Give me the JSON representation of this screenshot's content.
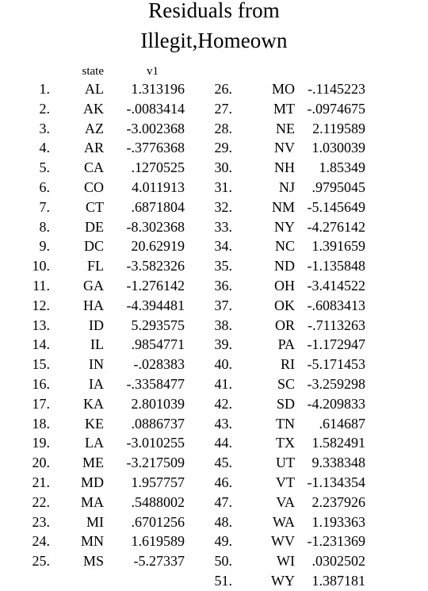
{
  "title": {
    "line1": "Residuals from",
    "line2": "Illegit,Homeown"
  },
  "columns": {
    "index_header": "",
    "state_header": "state",
    "value_header": "v1"
  },
  "chart_data": {
    "type": "table",
    "title": "Residuals from Illegit,Homeown",
    "xlabel": "state",
    "ylabel": "v1",
    "categories": [
      "AL",
      "AK",
      "AZ",
      "AR",
      "CA",
      "CO",
      "CT",
      "DE",
      "DC",
      "FL",
      "GA",
      "HA",
      "ID",
      "IL",
      "IN",
      "IA",
      "KA",
      "KE",
      "LA",
      "ME",
      "MD",
      "MA",
      "MI",
      "MN",
      "MS",
      "MO",
      "MT",
      "NE",
      "NV",
      "NH",
      "NJ",
      "NM",
      "NY",
      "NC",
      "ND",
      "OH",
      "OK",
      "OR",
      "PA",
      "RI",
      "SC",
      "SD",
      "TN",
      "TX",
      "UT",
      "VT",
      "VA",
      "WA",
      "WV",
      "WI",
      "WY"
    ],
    "values": [
      1.313196,
      -0.0083414,
      -3.002368,
      -0.3776368,
      0.1270525,
      4.011913,
      0.6871804,
      -8.302368,
      20.62919,
      -3.582326,
      -1.276142,
      -4.394481,
      5.293575,
      0.9854771,
      -0.028383,
      -0.3358477,
      2.801039,
      0.0886737,
      -3.010255,
      -3.217509,
      1.957757,
      0.5488002,
      0.6701256,
      1.619589,
      -5.27337,
      -0.1145223,
      -0.0974675,
      2.119589,
      1.030039,
      1.85349,
      0.9795045,
      -5.145649,
      -4.276142,
      1.391659,
      -1.135848,
      -3.414522,
      -0.6083413,
      -0.7113263,
      -1.172947,
      -5.171453,
      -3.259298,
      -4.209833,
      0.614687,
      1.582491,
      9.338348,
      -1.134354,
      2.237926,
      1.193363,
      -1.231369,
      0.0302502,
      1.387181
    ]
  },
  "left_rows": [
    {
      "num": "1.",
      "state": "AL",
      "value": "1.313196"
    },
    {
      "num": "2.",
      "state": "AK",
      "value": "-.0083414"
    },
    {
      "num": "3.",
      "state": "AZ",
      "value": "-3.002368"
    },
    {
      "num": "4.",
      "state": "AR",
      "value": "-.3776368"
    },
    {
      "num": "5.",
      "state": "CA",
      "value": ".1270525"
    },
    {
      "num": "6.",
      "state": "CO",
      "value": "4.011913"
    },
    {
      "num": "7.",
      "state": "CT",
      "value": ".6871804"
    },
    {
      "num": "8.",
      "state": "DE",
      "value": "-8.302368"
    },
    {
      "num": "9.",
      "state": "DC",
      "value": "20.62919"
    },
    {
      "num": "10.",
      "state": "FL",
      "value": "-3.582326"
    },
    {
      "num": "11.",
      "state": "GA",
      "value": "-1.276142"
    },
    {
      "num": "12.",
      "state": "HA",
      "value": "-4.394481"
    },
    {
      "num": "13.",
      "state": "ID",
      "value": "5.293575"
    },
    {
      "num": "14.",
      "state": "IL",
      "value": ".9854771"
    },
    {
      "num": "15.",
      "state": "IN",
      "value": "-.028383"
    },
    {
      "num": "16.",
      "state": "IA",
      "value": "-.3358477"
    },
    {
      "num": "17.",
      "state": "KA",
      "value": "2.801039"
    },
    {
      "num": "18.",
      "state": "KE",
      "value": ".0886737"
    },
    {
      "num": "19.",
      "state": "LA",
      "value": "-3.010255"
    },
    {
      "num": "20.",
      "state": "ME",
      "value": "-3.217509"
    },
    {
      "num": "21.",
      "state": "MD",
      "value": "1.957757"
    },
    {
      "num": "22.",
      "state": "MA",
      "value": ".5488002"
    },
    {
      "num": "23.",
      "state": "MI",
      "value": ".6701256"
    },
    {
      "num": "24.",
      "state": "MN",
      "value": "1.619589"
    },
    {
      "num": "25.",
      "state": "MS",
      "value": "-5.27337"
    }
  ],
  "right_rows": [
    {
      "num": "26.",
      "state": "MO",
      "value": "-.1145223"
    },
    {
      "num": "27.",
      "state": "MT",
      "value": "-.0974675"
    },
    {
      "num": "28.",
      "state": "NE",
      "value": "2.119589"
    },
    {
      "num": "29.",
      "state": "NV",
      "value": "1.030039"
    },
    {
      "num": "30.",
      "state": "NH",
      "value": "1.85349"
    },
    {
      "num": "31.",
      "state": "NJ",
      "value": ".9795045"
    },
    {
      "num": "32.",
      "state": "NM",
      "value": "-5.145649"
    },
    {
      "num": "33.",
      "state": "NY",
      "value": "-4.276142"
    },
    {
      "num": "34.",
      "state": "NC",
      "value": "1.391659"
    },
    {
      "num": "35.",
      "state": "ND",
      "value": "-1.135848"
    },
    {
      "num": "36.",
      "state": "OH",
      "value": "-3.414522"
    },
    {
      "num": "37.",
      "state": "OK",
      "value": "-.6083413"
    },
    {
      "num": "38.",
      "state": "OR",
      "value": "-.7113263"
    },
    {
      "num": "39.",
      "state": "PA",
      "value": "-1.172947"
    },
    {
      "num": "40.",
      "state": "RI",
      "value": "-5.171453"
    },
    {
      "num": "41.",
      "state": "SC",
      "value": "-3.259298"
    },
    {
      "num": "42.",
      "state": "SD",
      "value": "-4.209833"
    },
    {
      "num": "43.",
      "state": "TN",
      "value": ".614687"
    },
    {
      "num": "44.",
      "state": "TX",
      "value": "1.582491"
    },
    {
      "num": "45.",
      "state": "UT",
      "value": "9.338348"
    },
    {
      "num": "46.",
      "state": "VT",
      "value": "-1.134354"
    },
    {
      "num": "47.",
      "state": "VA",
      "value": "2.237926"
    },
    {
      "num": "48.",
      "state": "WA",
      "value": "1.193363"
    },
    {
      "num": "49.",
      "state": "WV",
      "value": "-1.231369"
    },
    {
      "num": "50.",
      "state": "WI",
      "value": ".0302502"
    },
    {
      "num": "51.",
      "state": "WY",
      "value": "1.387181"
    }
  ]
}
